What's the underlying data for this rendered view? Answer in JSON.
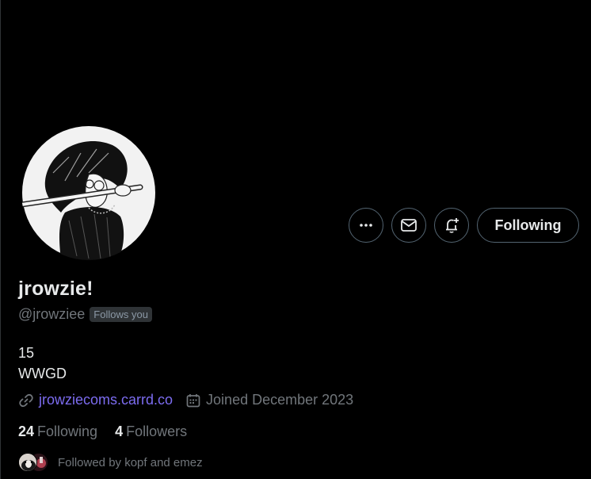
{
  "profile": {
    "display_name": "jrowzie!",
    "handle": "@jrowziee",
    "follows_you_badge": "Follows you",
    "bio_lines": [
      "15",
      "WWGD"
    ],
    "website": "jrowziecoms.carrd.co",
    "joined": "Joined December 2023",
    "following_count": "24",
    "following_label": "Following",
    "followers_count": "4",
    "followers_label": "Followers",
    "followed_by": "Followed by kopf and emez"
  },
  "actions": {
    "more_icon": "more-horizontal-icon",
    "message_icon": "envelope-icon",
    "notify_icon": "bell-plus-icon",
    "follow_button_label": "Following"
  },
  "icons": {
    "website": "link-icon",
    "joined": "calendar-icon"
  },
  "colors": {
    "background": "#000000",
    "text_primary": "#e7e9ea",
    "text_secondary": "#71767b",
    "link": "#7c6cf0",
    "border": "#536471"
  }
}
